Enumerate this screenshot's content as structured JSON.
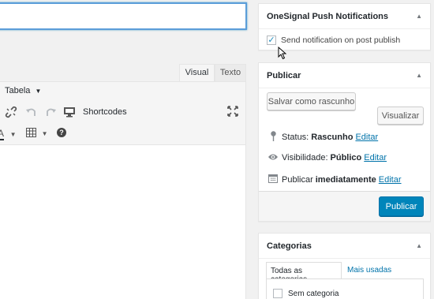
{
  "editor": {
    "tabs": {
      "visual": "Visual",
      "texto": "Texto"
    },
    "toolbar": {
      "table_menu": "Tabela",
      "shortcodes": "Shortcodes"
    }
  },
  "onesignal": {
    "title": "OneSignal Push Notifications",
    "send_label": "Send notification on post publish",
    "send_checked": true
  },
  "publish": {
    "title": "Publicar",
    "save_draft": "Salvar como rascunho",
    "preview": "Visualizar",
    "status_label": "Status:",
    "status_value": "Rascunho",
    "visibility_label": "Visibilidade:",
    "visibility_value": "Público",
    "schedule_label": "Publicar",
    "schedule_value": "imediatamente",
    "edit_link": "Editar",
    "publish_button": "Publicar"
  },
  "categories": {
    "title": "Categorias",
    "tab_all": "Todas as categorias",
    "tab_popular": "Mais usadas",
    "items": [
      {
        "label": "Sem categoria",
        "checked": false
      }
    ]
  },
  "colors": {
    "accent": "#0085ba",
    "link": "#0073aa",
    "background": "#f1f1f1"
  }
}
